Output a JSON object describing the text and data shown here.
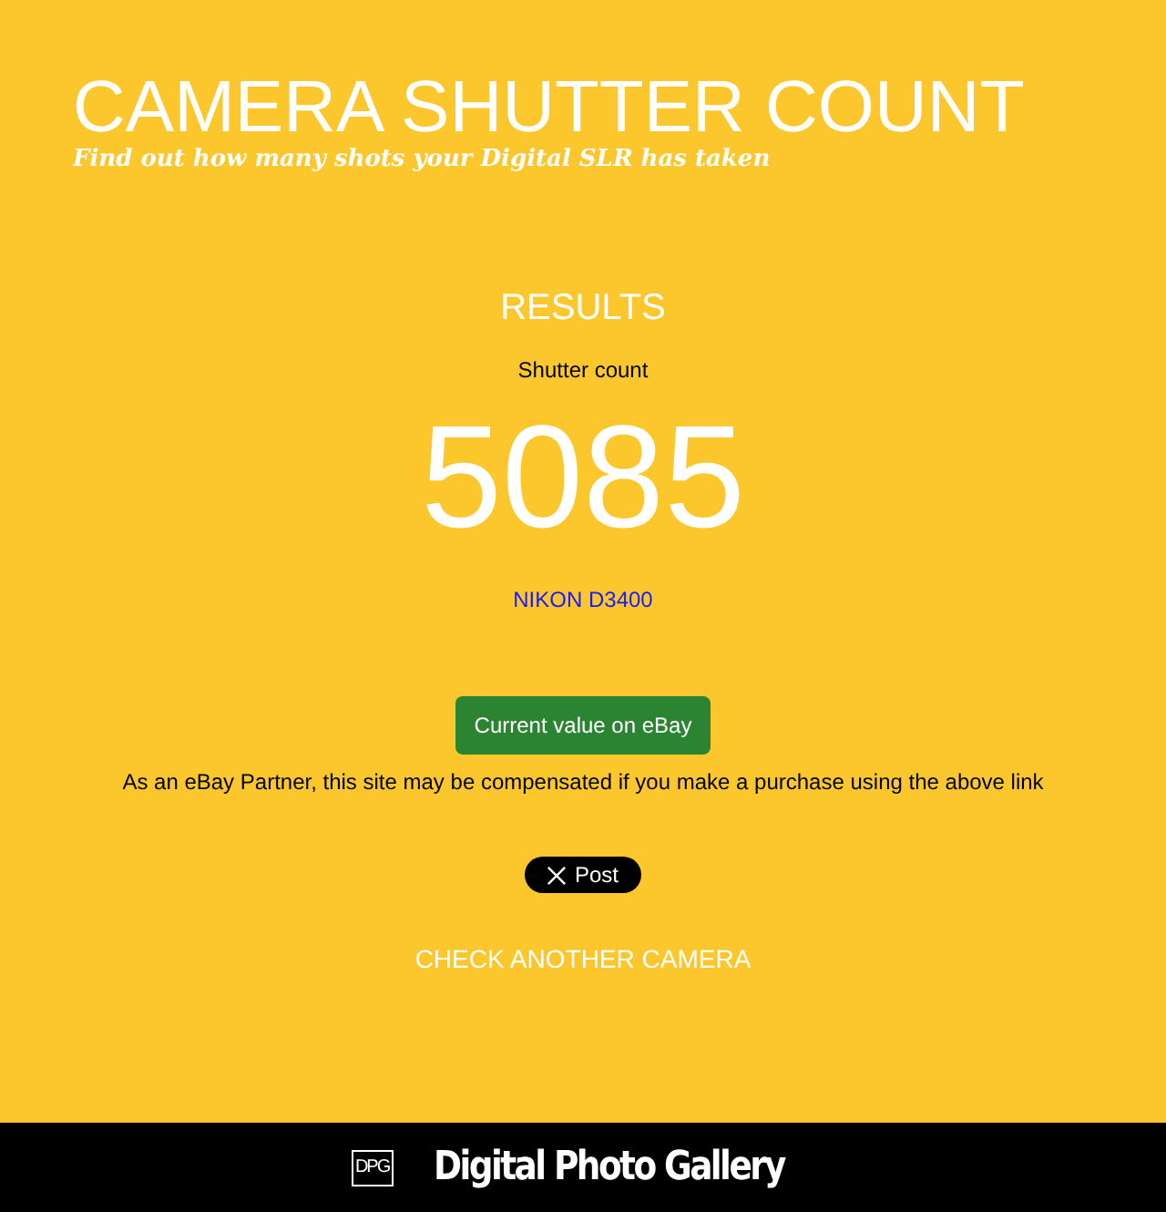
{
  "header": {
    "title": "CAMERA SHUTTER COUNT",
    "subtitle": "Find out how many shots your Digital SLR has taken"
  },
  "results": {
    "heading": "RESULTS",
    "label": "Shutter count",
    "count": "5085",
    "camera_link": "NIKON D3400"
  },
  "ebay_button": "Current value on eBay",
  "disclaimer": "As an eBay Partner, this site may be compensated if you make a purchase using the above link",
  "post_button": "Post",
  "check_link": "CHECK ANOTHER CAMERA",
  "footer": {
    "logo_mark": "DPG",
    "logo_text": "Digital Photo Gallery"
  }
}
